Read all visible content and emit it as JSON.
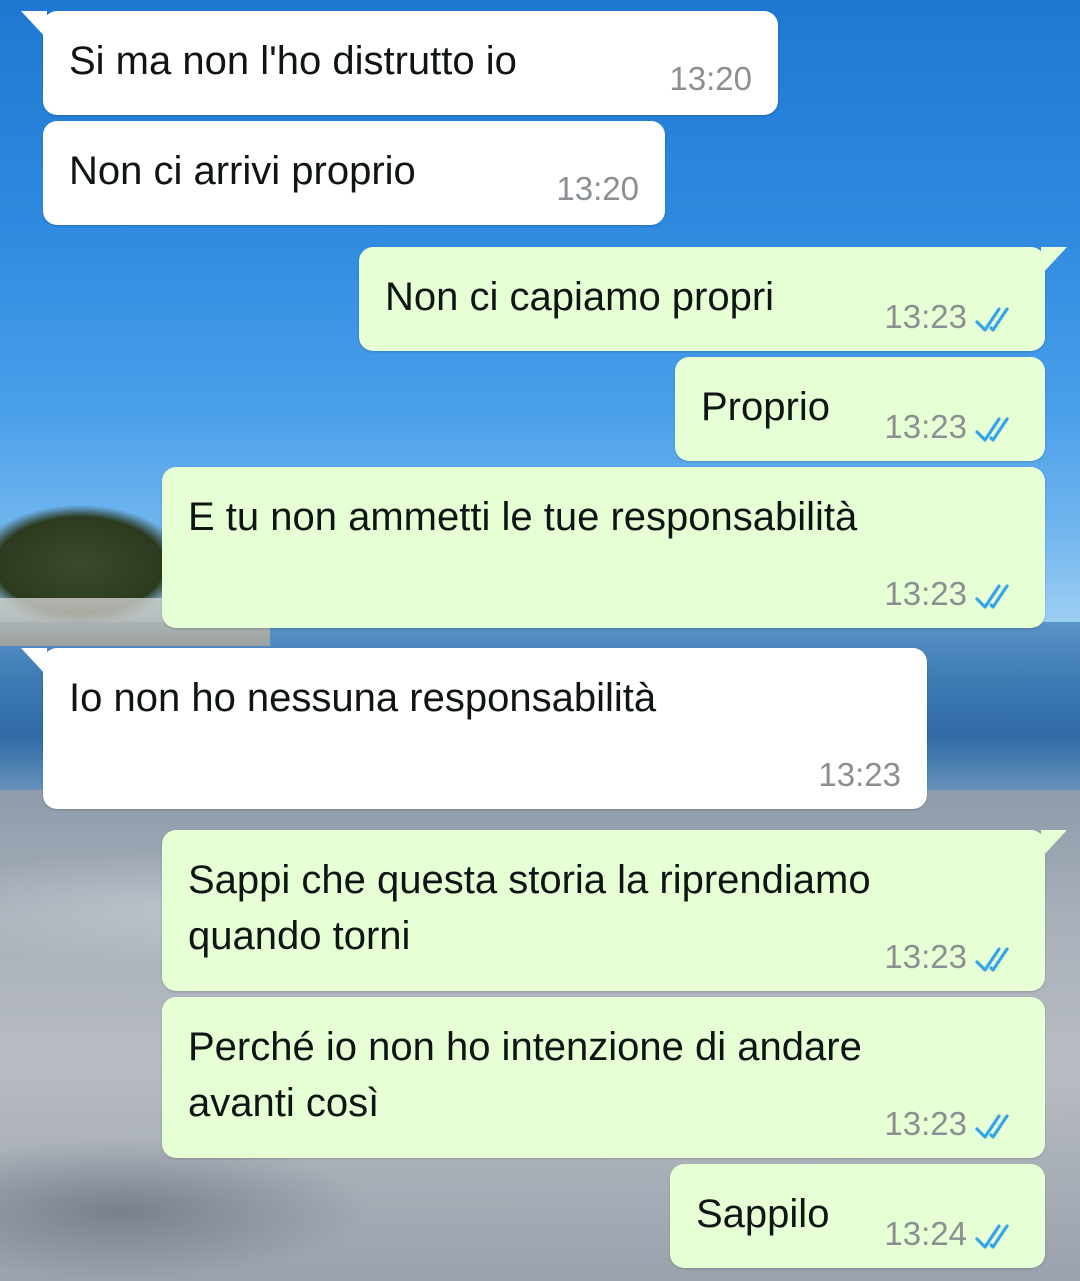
{
  "colors": {
    "incoming_bubble": "#ffffff",
    "outgoing_bubble": "#e7ffd5",
    "read_ticks": "#34a4e8",
    "timestamp": "#8a8f93"
  },
  "messages": [
    {
      "dir": "in",
      "text": "Si ma non l'ho distrutto io",
      "time": "13:20",
      "tail": true
    },
    {
      "dir": "in",
      "text": "Non ci arrivi proprio",
      "time": "13:20",
      "tail": false
    },
    {
      "dir": "out",
      "text": "Non ci capiamo propri",
      "time": "13:23",
      "status": "read",
      "tail": true
    },
    {
      "dir": "out",
      "text": "Proprio",
      "time": "13:23",
      "status": "read",
      "tail": false
    },
    {
      "dir": "out",
      "text": "E tu non ammetti le tue responsabilità",
      "time": "13:23",
      "status": "read",
      "tail": false
    },
    {
      "dir": "in",
      "text": "Io non ho nessuna responsabilità",
      "time": "13:23",
      "tail": true
    },
    {
      "dir": "out",
      "text": "Sappi che questa storia la riprendiamo\nquando torni",
      "time": "13:23",
      "status": "read",
      "tail": true
    },
    {
      "dir": "out",
      "text": "Perché io non ho intenzione di andare\navanti così",
      "time": "13:23",
      "status": "read",
      "tail": false
    },
    {
      "dir": "out",
      "text": "Sappilo",
      "time": "13:24",
      "status": "read",
      "tail": false
    }
  ]
}
